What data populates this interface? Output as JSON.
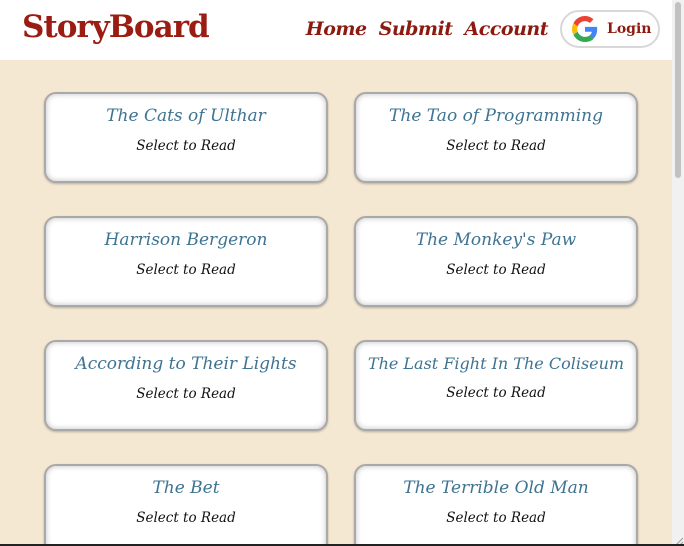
{
  "header": {
    "brand": "StoryBoard",
    "nav": [
      "Home",
      "Submit",
      "Account"
    ],
    "login_label": "Login",
    "login_icon": "google-icon"
  },
  "stories": [
    {
      "title": "The Cats of Ulthar",
      "action": "Select to Read"
    },
    {
      "title": "The Tao of Programming",
      "action": "Select to Read"
    },
    {
      "title": "Harrison Bergeron",
      "action": "Select to Read"
    },
    {
      "title": "The Monkey's Paw",
      "action": "Select to Read"
    },
    {
      "title": "According to Their Lights",
      "action": "Select to Read"
    },
    {
      "title": "The Last Fight In The Coliseum",
      "action": "Select to Read"
    },
    {
      "title": "The Bet",
      "action": "Select to Read"
    },
    {
      "title": "The Terrible Old Man",
      "action": "Select to Read"
    }
  ],
  "colors": {
    "brand": "#9b1c12",
    "nav": "#8d1a10",
    "card_title": "#3e7392",
    "background": "#f5e8d3"
  }
}
